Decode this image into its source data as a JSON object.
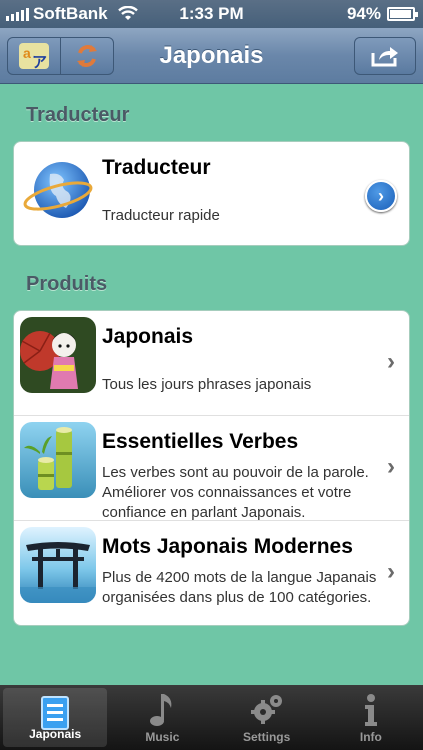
{
  "status_bar": {
    "carrier": "SoftBank",
    "time": "1:33 PM",
    "battery": "94%",
    "battery_level": 0.94
  },
  "nav": {
    "title": "Japonais",
    "left_icons": [
      "translate-icon",
      "refresh-icon"
    ],
    "right_icon": "share-icon"
  },
  "sections": [
    {
      "header": "Traducteur",
      "rows": [
        {
          "title": "Traducteur",
          "desc": "Traducteur rapide",
          "icon": "globe-icon",
          "accessory": "detail-disclosure"
        }
      ]
    },
    {
      "header": "Produits",
      "rows": [
        {
          "title": "Japonais",
          "desc": "Tous les jours phrases japonais",
          "icon": "kimono-doll-icon",
          "accessory": "chevron"
        },
        {
          "title": "Essentielles Verbes",
          "desc": "Les verbes sont au pouvoir de la parole. Améliorer vos connaissances et votre confiance en parlant Japonais.",
          "icon": "bamboo-icon",
          "accessory": "chevron"
        },
        {
          "title": "Mots Japonais Modernes",
          "desc": "Plus de 4200 mots de la langue Japanais organisées dans plus de 100 catégories.",
          "icon": "torii-gate-icon",
          "accessory": "chevron"
        }
      ]
    }
  ],
  "tabs": [
    {
      "label": "Japonais",
      "icon": "list-icon",
      "selected": true
    },
    {
      "label": "Music",
      "icon": "music-note-icon",
      "selected": false
    },
    {
      "label": "Settings",
      "icon": "gears-icon",
      "selected": false
    },
    {
      "label": "Info",
      "icon": "info-icon",
      "selected": false
    }
  ],
  "colors": {
    "background": "#6fc6a6",
    "nav_bar": "#6a87aa",
    "tab_bar": "#1e1e1e"
  }
}
